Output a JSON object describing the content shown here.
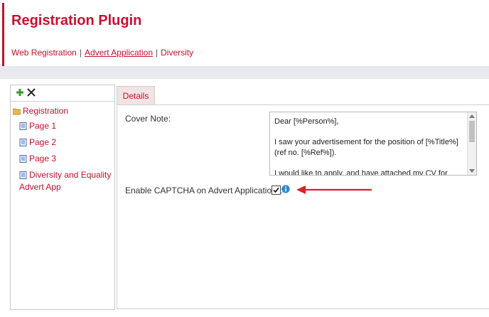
{
  "header": {
    "title": "Registration Plugin",
    "breadcrumb": [
      "Web Registration",
      "Advert Application",
      "Diversity"
    ],
    "separator": "|",
    "accent_color": "#c8102e"
  },
  "toolbar": {
    "add_icon": "plus-icon",
    "delete_icon": "close-icon"
  },
  "tree": {
    "root": {
      "label": "Registration",
      "icon": "folder-icon"
    },
    "items": [
      {
        "label": "Page 1",
        "icon": "page-icon"
      },
      {
        "label": "Page 2",
        "icon": "page-icon"
      },
      {
        "label": "Page 3",
        "icon": "page-icon"
      },
      {
        "label": "Diversity and Equality",
        "label2": "Advert App",
        "icon": "page-icon"
      }
    ]
  },
  "tabs": [
    {
      "label": "Details"
    }
  ],
  "form": {
    "cover_note_label": "Cover Note:",
    "cover_note_value": "Dear [%Person%],\n\nI saw your advertisement for the position of [%Title%] (ref no. [%Ref%]).\n\nI would like to apply, and have attached my CV for your",
    "captcha_label": "Enable CAPTCHA on Advert Applications:",
    "captcha_checked": true,
    "info_icon": "info-icon"
  }
}
